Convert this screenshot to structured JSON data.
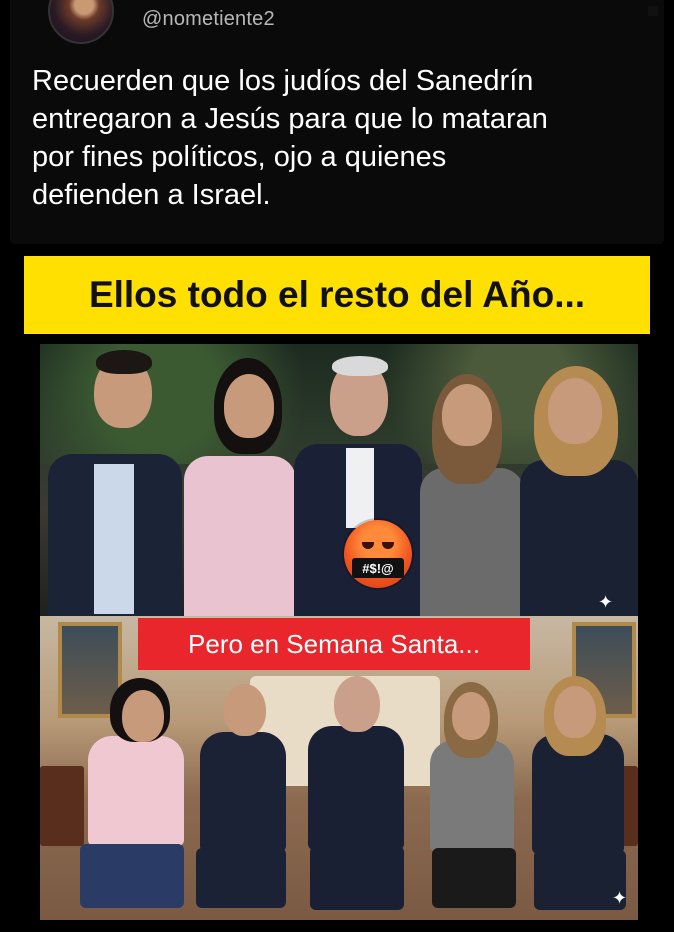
{
  "tweet": {
    "handle": "@nometiente2",
    "text": "Recuerden que los judíos del Sanedrín\nentregaron a Jesús para que lo mataran\npor fines políticos, ojo a quienes\ndefienden a Israel."
  },
  "meme": {
    "banner_text": "Ellos todo el resto del Año...",
    "emoji_text": "#$!@",
    "label_text": "Pero en Semana Santa...",
    "colors": {
      "banner_bg": "#ffe000",
      "label_bg": "#e8262c"
    },
    "icons": [
      "angry-face-emoji",
      "sparkle-icon"
    ]
  }
}
